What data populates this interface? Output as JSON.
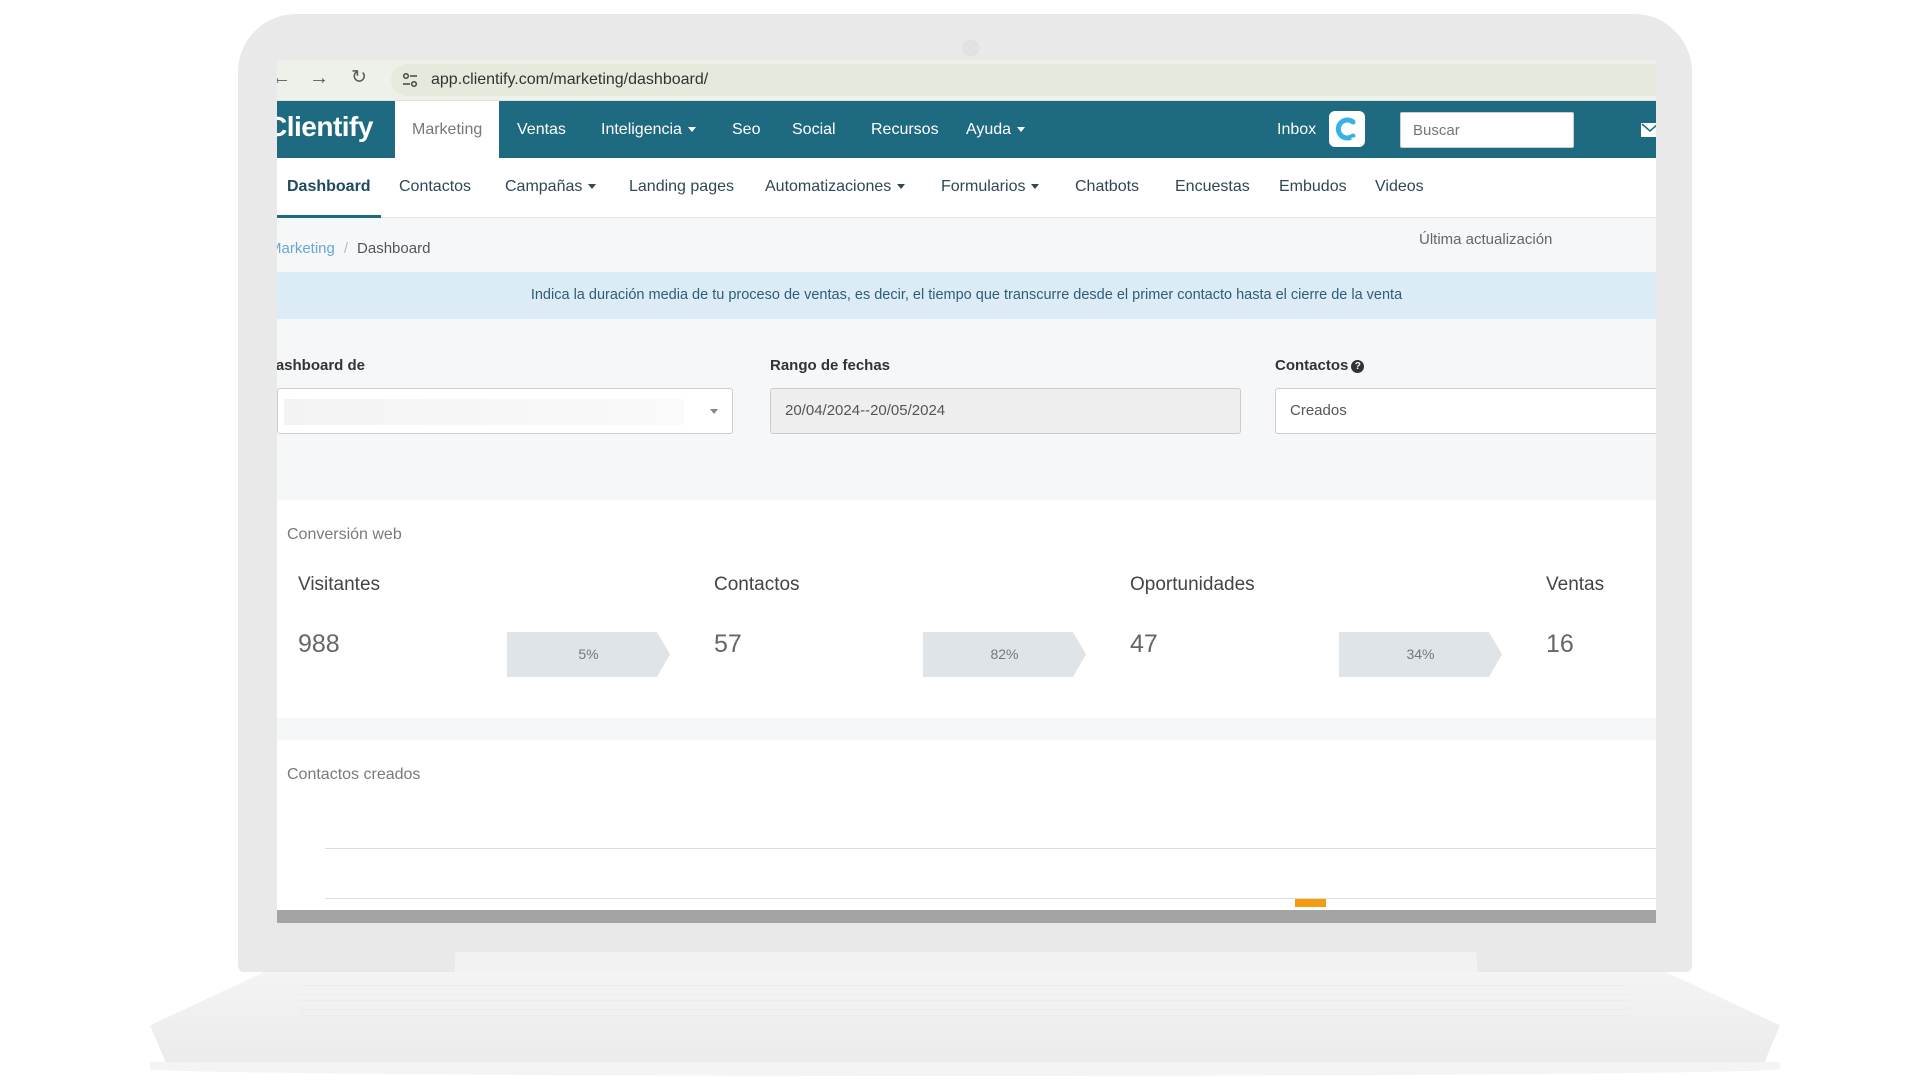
{
  "browser": {
    "url": "app.clientify.com/marketing/dashboard/"
  },
  "topnav": {
    "logo": "Clientify",
    "items": [
      {
        "label": "Marketing",
        "active": true
      },
      {
        "label": "Ventas"
      },
      {
        "label": "Inteligencia",
        "dropdown": true
      },
      {
        "label": "Seo"
      },
      {
        "label": "Social"
      },
      {
        "label": "Recursos"
      },
      {
        "label": "Ayuda",
        "dropdown": true
      }
    ],
    "inbox_label": "Inbox",
    "search_placeholder": "Buscar"
  },
  "subnav": {
    "items": [
      {
        "label": "Dashboard",
        "active": true
      },
      {
        "label": "Contactos"
      },
      {
        "label": "Campañas",
        "dropdown": true
      },
      {
        "label": "Landing pages"
      },
      {
        "label": "Automatizaciones",
        "dropdown": true
      },
      {
        "label": "Formularios",
        "dropdown": true
      },
      {
        "label": "Chatbots"
      },
      {
        "label": "Encuestas"
      },
      {
        "label": "Embudos"
      },
      {
        "label": "Videos"
      }
    ]
  },
  "breadcrumb": {
    "parent": "Marketing",
    "current": "Dashboard"
  },
  "last_update_label": "Última actualización",
  "info_banner": "Indica la duración media de tu proceso de ventas, es decir, el tiempo que transcurre desde el primer contacto hasta el cierre de la venta",
  "filters": {
    "dashboard_label": "Dashboard de",
    "dashboard_value": "",
    "date_range_label": "Rango de fechas",
    "date_range_value": "20/04/2024--20/05/2024",
    "contacts_label": "Contactos",
    "contacts_value": "Creados"
  },
  "conversion": {
    "title": "Conversión web",
    "metrics": [
      {
        "label": "Visitantes",
        "value": "988"
      },
      {
        "label": "Contactos",
        "value": "57"
      },
      {
        "label": "Oportunidades",
        "value": "47"
      },
      {
        "label": "Ventas",
        "value": "16"
      }
    ],
    "rates": [
      "5%",
      "82%",
      "34%"
    ]
  },
  "contacts_chart": {
    "title": "Contactos creados"
  },
  "colors": {
    "topnav_bg": "#1d6a81",
    "banner_bg": "#dcecf6",
    "chart_bar": "#f39c12",
    "link": "#6aa6d3"
  }
}
